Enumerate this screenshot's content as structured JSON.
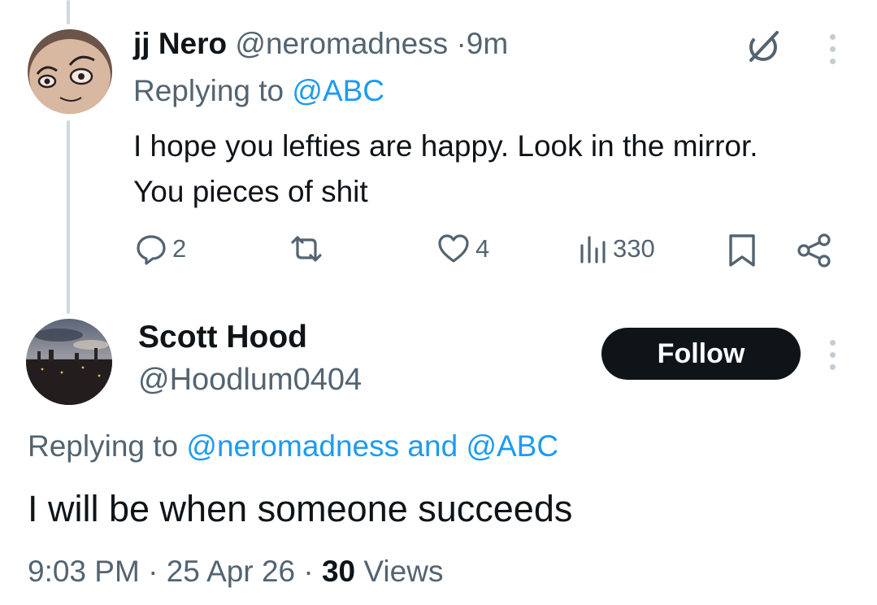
{
  "reply_tweet": {
    "author_name": "jj Nero",
    "handle": "@neromadness",
    "separator": "·",
    "time": "9m",
    "replying_prefix": "Replying to",
    "replying_to": "@ABC",
    "body": "I hope you lefties are happy. Look in the mirror. You pieces of shit",
    "actions": {
      "reply_count": "2",
      "retweet_count": "",
      "like_count": "4",
      "views_count": "330"
    },
    "icons": {
      "grok": "grok-slash-icon",
      "more": "more-dots-icon",
      "reply": "reply-icon",
      "retweet": "retweet-icon",
      "like": "heart-icon",
      "views": "views-bar-icon",
      "bookmark": "bookmark-icon",
      "share": "share-icon"
    }
  },
  "main_tweet": {
    "author_name": "Scott Hood",
    "handle": "@Hoodlum0404",
    "follow_label": "Follow",
    "replying_prefix": "Replying to",
    "replying_to_1": "@neromadness",
    "replying_and": "and",
    "replying_to_2": "@ABC",
    "body": "I will be when someone succeeds",
    "timestamp_time": "9:03 PM",
    "separator": "·",
    "timestamp_date": "25 Apr 26",
    "views_count": "30",
    "views_label": "Views"
  },
  "colors": {
    "text": "#0f1419",
    "muted": "#536471",
    "link": "#1d9bf0",
    "button_bg": "#0f1419",
    "thread_line": "#cfd9de"
  }
}
